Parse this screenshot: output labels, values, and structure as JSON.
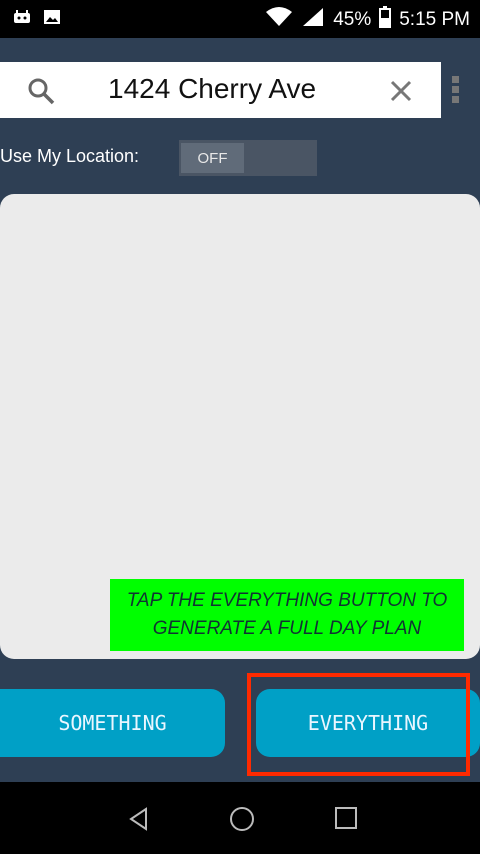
{
  "status_bar": {
    "battery_percent": "45%",
    "time": "5:15 PM"
  },
  "search": {
    "value": "1424 Cherry Ave"
  },
  "location": {
    "label": "Use My Location:",
    "toggle_state": "OFF"
  },
  "tip": {
    "text": "TAP THE EVERYTHING BUTTON TO GENERATE A FULL DAY PLAN"
  },
  "buttons": {
    "something": "SOMETHING",
    "everything": "EVERYTHING"
  },
  "colors": {
    "background": "#2e3f54",
    "button": "#00a0c6",
    "tip": "#00ff00",
    "highlight": "#ff2a00"
  }
}
